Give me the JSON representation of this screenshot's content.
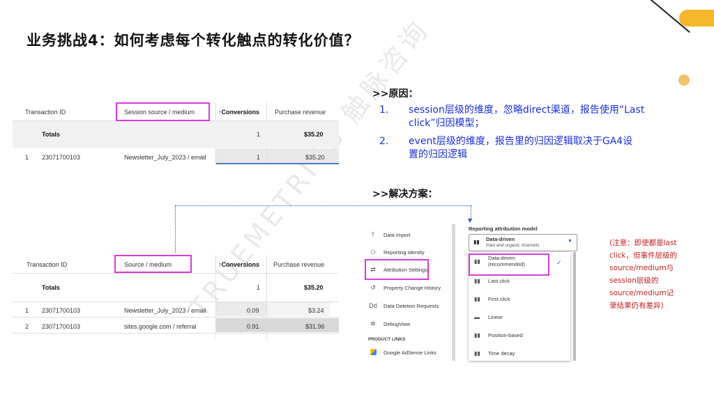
{
  "title": "业务挑战4：如何考虑每个转化触点的转化价值？",
  "watermark": "TRUEMETRICS 触脉咨询",
  "colors": {
    "accent_yellow": "#f5b62a",
    "highlight_magenta": "#d63bd6",
    "reason_blue": "#1a2fd6",
    "note_red": "#c41e1e"
  },
  "table1": {
    "headers": {
      "transaction_id": "Transaction ID",
      "session_source": "Session source / medium",
      "conversions": "↑Conversions",
      "revenue": "Purchase revenue"
    },
    "totals": {
      "label": "Totals",
      "conversions": "1",
      "revenue": "$35.20"
    },
    "rows": [
      {
        "index": "1",
        "id": "23071700103",
        "source": "Newsletter_July_2023 / email",
        "conversions": "1",
        "revenue": "$35.20"
      }
    ]
  },
  "table2": {
    "headers": {
      "transaction_id": "Transaction ID",
      "source": "Source / medium",
      "conversions": "↑Conversions",
      "revenue": "Purchase revenue"
    },
    "totals": {
      "label": "Totals",
      "conversions": "1",
      "revenue": "$35.20"
    },
    "rows": [
      {
        "index": "1",
        "id": "23071700103",
        "source": "Newsletter_July_2023 / email",
        "conversions": "0.09",
        "revenue": "$3.24"
      },
      {
        "index": "2",
        "id": "23071700103",
        "source": "sites.google.com / referral",
        "conversions": "0.91",
        "revenue": "$31.96"
      }
    ]
  },
  "reason": {
    "heading": ">>原因：",
    "items": [
      {
        "num": "1.",
        "line1": "session层级的维度，忽略direct渠道，报告使用“Last",
        "line2": "click”归因模型；"
      },
      {
        "num": "2.",
        "line1": "event层级的维度，报告里的归因逻辑取决于GA4设",
        "line2": "置的归因逻辑"
      }
    ]
  },
  "solution": {
    "heading": ">>解决方案："
  },
  "settings_menu": {
    "items": [
      {
        "icon": "data-import-icon",
        "glyph": "⤒",
        "label": "Data import"
      },
      {
        "icon": "reporting-identity-icon",
        "glyph": "⚇",
        "label": "Reporting Identity"
      },
      {
        "icon": "attribution-settings-icon",
        "glyph": "⇄",
        "label": "Attribution Settings"
      },
      {
        "icon": "history-icon",
        "glyph": "↺",
        "label": "Property Change History"
      },
      {
        "icon": "dd-icon",
        "glyph": "Dd",
        "label": "Data Deletion Requests"
      },
      {
        "icon": "debug-icon",
        "glyph": "✲",
        "label": "DebugView"
      }
    ],
    "section_label": "PRODUCT LINKS",
    "adsense": "Google AdSense Links"
  },
  "attribution": {
    "label": "Reporting attribution model",
    "selected_main": "Data-driven",
    "selected_sub": "Paid and organic channels",
    "options": [
      {
        "line1": "Data-driven",
        "line2": "(recommended)"
      },
      {
        "line1": "Last click",
        "line2": ""
      },
      {
        "line1": "First click",
        "line2": ""
      },
      {
        "line1": "Linear",
        "line2": ""
      },
      {
        "line1": "Position-based",
        "line2": ""
      },
      {
        "line1": "Time decay",
        "line2": ""
      }
    ]
  },
  "note": {
    "lines": [
      "(注意：即使都是last",
      "click，但事件层级的",
      "source/medium与",
      "session层级的",
      "source/medium记",
      "录结果仍有差异)"
    ]
  }
}
